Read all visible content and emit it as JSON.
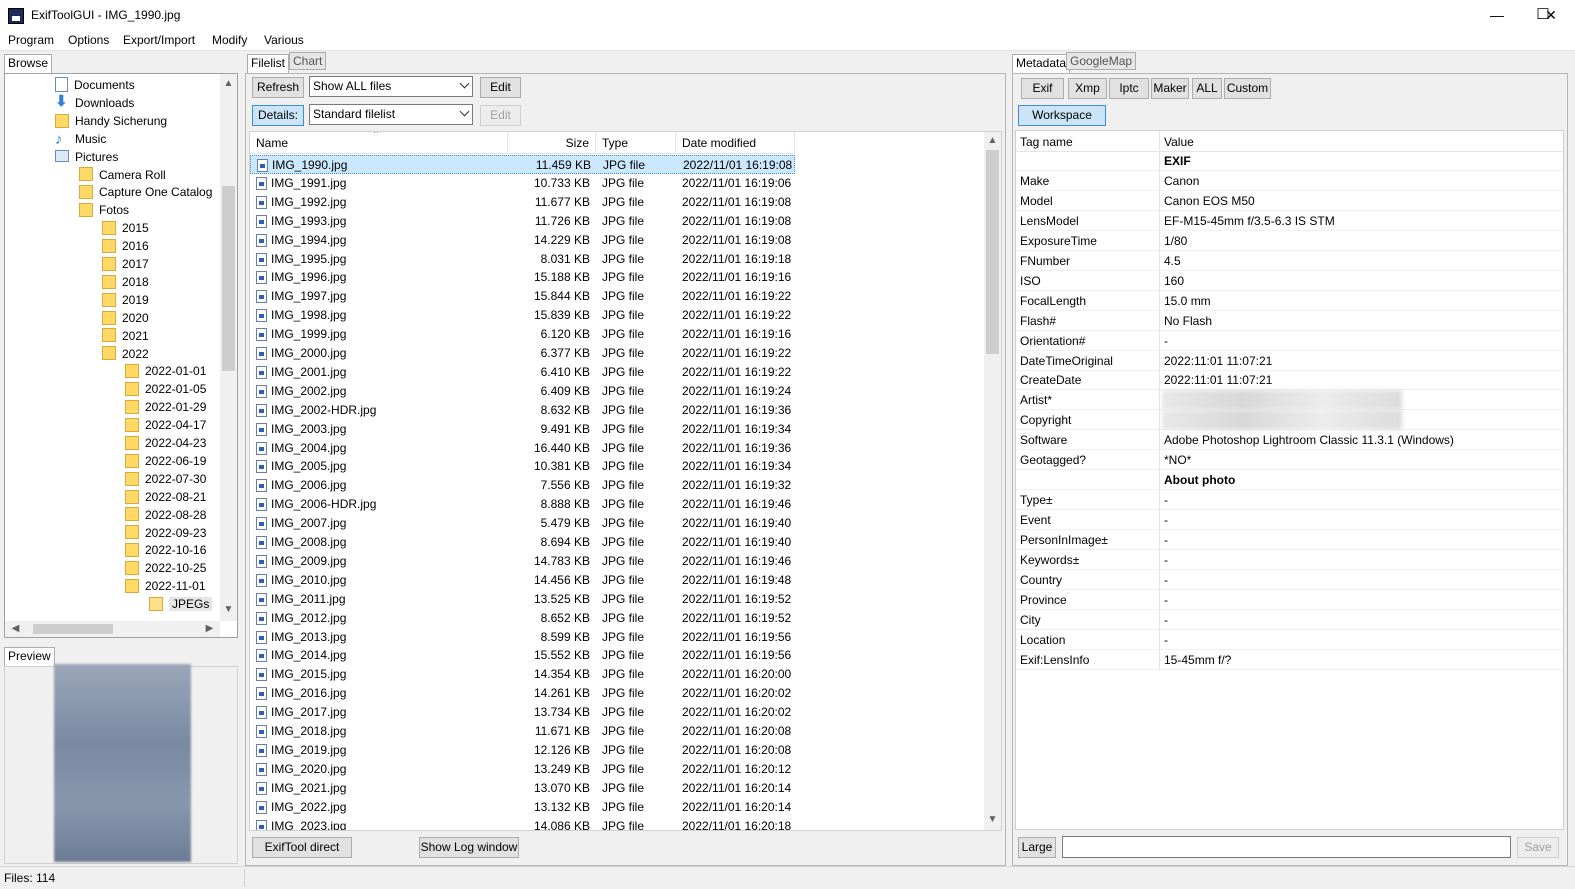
{
  "window": {
    "title": "ExifToolGUI - IMG_1990.jpg",
    "minimize_glyph": "—",
    "maximize_glyph": "☐",
    "close_glyph": "✕"
  },
  "menu": [
    "Program",
    "Options",
    "Export/Import",
    "Modify",
    "Various"
  ],
  "browse": {
    "tab_label": "Browse",
    "tree": [
      {
        "label": "Documents",
        "icon": "doc-icon",
        "level": 0
      },
      {
        "label": "Downloads",
        "icon": "download-icon",
        "level": 0
      },
      {
        "label": "Handy Sicherung",
        "icon": "folder-icon",
        "level": 0
      },
      {
        "label": "Music",
        "icon": "music-icon",
        "level": 0
      },
      {
        "label": "Pictures",
        "icon": "pictures-icon",
        "level": 0
      },
      {
        "label": "Camera Roll",
        "icon": "folder-icon",
        "level": 1
      },
      {
        "label": "Capture One Catalog",
        "icon": "folder-icon",
        "level": 1
      },
      {
        "label": "Fotos",
        "icon": "folder-icon",
        "level": 1
      },
      {
        "label": "2015",
        "icon": "folder-icon",
        "level": 2
      },
      {
        "label": "2016",
        "icon": "folder-icon",
        "level": 2
      },
      {
        "label": "2017",
        "icon": "folder-icon",
        "level": 2
      },
      {
        "label": "2018",
        "icon": "folder-icon",
        "level": 2
      },
      {
        "label": "2019",
        "icon": "folder-icon",
        "level": 2
      },
      {
        "label": "2020",
        "icon": "folder-icon",
        "level": 2
      },
      {
        "label": "2021",
        "icon": "folder-icon",
        "level": 2
      },
      {
        "label": "2022",
        "icon": "folder-icon",
        "level": 2
      },
      {
        "label": "2022-01-01",
        "icon": "folder-icon",
        "level": 3
      },
      {
        "label": "2022-01-05",
        "icon": "folder-icon",
        "level": 3
      },
      {
        "label": "2022-01-29",
        "icon": "folder-icon",
        "level": 3
      },
      {
        "label": "2022-04-17",
        "icon": "folder-icon",
        "level": 3
      },
      {
        "label": "2022-04-23",
        "icon": "folder-icon",
        "level": 3
      },
      {
        "label": "2022-06-19",
        "icon": "folder-icon",
        "level": 3
      },
      {
        "label": "2022-07-30",
        "icon": "folder-icon",
        "level": 3
      },
      {
        "label": "2022-08-21",
        "icon": "folder-icon",
        "level": 3
      },
      {
        "label": "2022-08-28",
        "icon": "folder-icon",
        "level": 3
      },
      {
        "label": "2022-09-23",
        "icon": "folder-icon",
        "level": 3
      },
      {
        "label": "2022-10-16",
        "icon": "folder-icon",
        "level": 3
      },
      {
        "label": "2022-10-25",
        "icon": "folder-icon",
        "level": 3
      },
      {
        "label": "2022-11-01",
        "icon": "folder-icon",
        "level": 3
      },
      {
        "label": "JPEGs",
        "icon": "folder-icon",
        "level": 4,
        "selected": true
      }
    ]
  },
  "preview": {
    "tab_label": "Preview"
  },
  "filelist": {
    "tabs": [
      "Filelist",
      "Chart"
    ],
    "refresh_label": "Refresh",
    "filter_value": "Show ALL files",
    "edit_label": "Edit",
    "details_label": "Details:",
    "view_value": "Standard filelist",
    "edit2_label": "Edit",
    "columns": [
      "Name",
      "Size",
      "Type",
      "Date modified"
    ],
    "rows": [
      [
        "IMG_1990.jpg",
        "11.459 KB",
        "JPG file",
        "2022/11/01 16:19:08"
      ],
      [
        "IMG_1991.jpg",
        "10.733 KB",
        "JPG file",
        "2022/11/01 16:19:06"
      ],
      [
        "IMG_1992.jpg",
        "11.677 KB",
        "JPG file",
        "2022/11/01 16:19:08"
      ],
      [
        "IMG_1993.jpg",
        "11.726 KB",
        "JPG file",
        "2022/11/01 16:19:08"
      ],
      [
        "IMG_1994.jpg",
        "14.229 KB",
        "JPG file",
        "2022/11/01 16:19:08"
      ],
      [
        "IMG_1995.jpg",
        "8.031 KB",
        "JPG file",
        "2022/11/01 16:19:18"
      ],
      [
        "IMG_1996.jpg",
        "15.188 KB",
        "JPG file",
        "2022/11/01 16:19:16"
      ],
      [
        "IMG_1997.jpg",
        "15.844 KB",
        "JPG file",
        "2022/11/01 16:19:22"
      ],
      [
        "IMG_1998.jpg",
        "15.839 KB",
        "JPG file",
        "2022/11/01 16:19:22"
      ],
      [
        "IMG_1999.jpg",
        "6.120 KB",
        "JPG file",
        "2022/11/01 16:19:16"
      ],
      [
        "IMG_2000.jpg",
        "6.377 KB",
        "JPG file",
        "2022/11/01 16:19:22"
      ],
      [
        "IMG_2001.jpg",
        "6.410 KB",
        "JPG file",
        "2022/11/01 16:19:22"
      ],
      [
        "IMG_2002.jpg",
        "6.409 KB",
        "JPG file",
        "2022/11/01 16:19:24"
      ],
      [
        "IMG_2002-HDR.jpg",
        "8.632 KB",
        "JPG file",
        "2022/11/01 16:19:36"
      ],
      [
        "IMG_2003.jpg",
        "9.491 KB",
        "JPG file",
        "2022/11/01 16:19:34"
      ],
      [
        "IMG_2004.jpg",
        "16.440 KB",
        "JPG file",
        "2022/11/01 16:19:36"
      ],
      [
        "IMG_2005.jpg",
        "10.381 KB",
        "JPG file",
        "2022/11/01 16:19:34"
      ],
      [
        "IMG_2006.jpg",
        "7.556 KB",
        "JPG file",
        "2022/11/01 16:19:32"
      ],
      [
        "IMG_2006-HDR.jpg",
        "8.888 KB",
        "JPG file",
        "2022/11/01 16:19:46"
      ],
      [
        "IMG_2007.jpg",
        "5.479 KB",
        "JPG file",
        "2022/11/01 16:19:40"
      ],
      [
        "IMG_2008.jpg",
        "8.694 KB",
        "JPG file",
        "2022/11/01 16:19:40"
      ],
      [
        "IMG_2009.jpg",
        "14.783 KB",
        "JPG file",
        "2022/11/01 16:19:46"
      ],
      [
        "IMG_2010.jpg",
        "14.456 KB",
        "JPG file",
        "2022/11/01 16:19:48"
      ],
      [
        "IMG_2011.jpg",
        "13.525 KB",
        "JPG file",
        "2022/11/01 16:19:52"
      ],
      [
        "IMG_2012.jpg",
        "8.652 KB",
        "JPG file",
        "2022/11/01 16:19:52"
      ],
      [
        "IMG_2013.jpg",
        "8.599 KB",
        "JPG file",
        "2022/11/01 16:19:56"
      ],
      [
        "IMG_2014.jpg",
        "15.552 KB",
        "JPG file",
        "2022/11/01 16:19:56"
      ],
      [
        "IMG_2015.jpg",
        "14.354 KB",
        "JPG file",
        "2022/11/01 16:20:00"
      ],
      [
        "IMG_2016.jpg",
        "14.261 KB",
        "JPG file",
        "2022/11/01 16:20:02"
      ],
      [
        "IMG_2017.jpg",
        "13.734 KB",
        "JPG file",
        "2022/11/01 16:20:02"
      ],
      [
        "IMG_2018.jpg",
        "11.671 KB",
        "JPG file",
        "2022/11/01 16:20:08"
      ],
      [
        "IMG_2019.jpg",
        "12.126 KB",
        "JPG file",
        "2022/11/01 16:20:08"
      ],
      [
        "IMG_2020.jpg",
        "13.249 KB",
        "JPG file",
        "2022/11/01 16:20:12"
      ],
      [
        "IMG_2021.jpg",
        "13.070 KB",
        "JPG file",
        "2022/11/01 16:20:14"
      ],
      [
        "IMG_2022.jpg",
        "13.132 KB",
        "JPG file",
        "2022/11/01 16:20:14"
      ],
      [
        "IMG_2023.jpg",
        "14.086 KB",
        "JPG file",
        "2022/11/01 16:20:18"
      ]
    ],
    "exiftool_direct_label": "ExifTool direct",
    "show_log_label": "Show Log window"
  },
  "metadata": {
    "tabs": [
      "Metadata",
      "GoogleMap"
    ],
    "buttons": [
      "Exif",
      "Xmp",
      "Iptc",
      "Maker",
      "ALL",
      "Custom"
    ],
    "workspace_label": "Workspace",
    "columns": [
      "Tag name",
      "Value"
    ],
    "rows": [
      {
        "tag": "",
        "value": "EXIF",
        "header": true
      },
      {
        "tag": "Make",
        "value": "Canon"
      },
      {
        "tag": "Model",
        "value": "Canon EOS M50"
      },
      {
        "tag": "LensModel",
        "value": "EF-M15-45mm f/3.5-6.3 IS STM"
      },
      {
        "tag": "ExposureTime",
        "value": "1/80"
      },
      {
        "tag": "FNumber",
        "value": "4.5"
      },
      {
        "tag": "ISO",
        "value": "160"
      },
      {
        "tag": "FocalLength",
        "value": "15.0 mm"
      },
      {
        "tag": "Flash#",
        "value": "No Flash"
      },
      {
        "tag": "Orientation#",
        "value": "-"
      },
      {
        "tag": "DateTimeOriginal",
        "value": "2022:11:01 11:07:21"
      },
      {
        "tag": "CreateDate",
        "value": "2022:11:01 11:07:21"
      },
      {
        "tag": "Artist*",
        "value": "",
        "blurred": true
      },
      {
        "tag": "Copyright",
        "value": "",
        "blurred": true
      },
      {
        "tag": "Software",
        "value": "Adobe Photoshop Lightroom Classic 11.3.1 (Windows)"
      },
      {
        "tag": "Geotagged?",
        "value": "*NO*"
      },
      {
        "tag": "",
        "value": "About photo",
        "header": true
      },
      {
        "tag": "Type±",
        "value": "-"
      },
      {
        "tag": "Event",
        "value": "-"
      },
      {
        "tag": "PersonInImage±",
        "value": "-"
      },
      {
        "tag": "Keywords±",
        "value": "-"
      },
      {
        "tag": "Country",
        "value": "-"
      },
      {
        "tag": "Province",
        "value": "-"
      },
      {
        "tag": "City",
        "value": "-"
      },
      {
        "tag": "Location",
        "value": "-"
      },
      {
        "tag": "Exif:LensInfo",
        "value": "15-45mm f/?"
      }
    ],
    "large_label": "Large",
    "save_label": "Save"
  },
  "statusbar": {
    "files": "Files: 114"
  }
}
